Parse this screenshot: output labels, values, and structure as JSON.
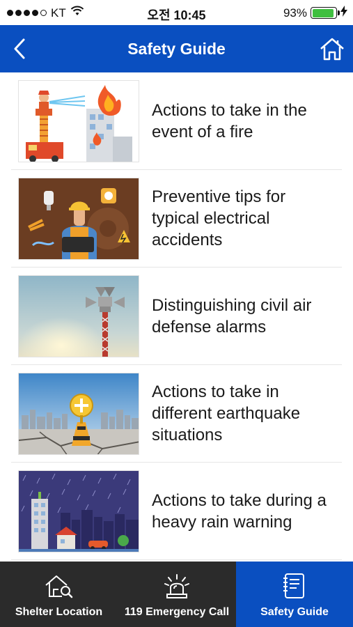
{
  "status_bar": {
    "carrier": "KT",
    "time": "오전 10:45",
    "battery_percent": "93%",
    "battery_level": 0.93,
    "signal_bars_filled": 4,
    "signal_bars_total": 5
  },
  "nav": {
    "title": "Safety Guide",
    "back_icon": "chevron-left-icon",
    "home_icon": "home-icon"
  },
  "guides": [
    {
      "title": "Actions to take in the event of a fire",
      "image": "firefighter-illustration"
    },
    {
      "title": "Preventive tips for typical electrical accidents",
      "image": "electrician-illustration"
    },
    {
      "title": "Distinguishing civil air defense alarms",
      "image": "siren-tower-photo"
    },
    {
      "title": "Actions to take in different earthquake situations",
      "image": "earthquake-crack-illustration"
    },
    {
      "title": "Actions to take during a heavy rain warning",
      "image": "heavy-rain-city-illustration"
    }
  ],
  "tabs": [
    {
      "label": "Shelter Location",
      "icon": "shelter-search-icon",
      "active": false
    },
    {
      "label": "119 Emergency Call",
      "icon": "emergency-siren-icon",
      "active": false
    },
    {
      "label": "Safety Guide",
      "icon": "guide-book-icon",
      "active": true
    }
  ],
  "colors": {
    "primary": "#0a4fc0",
    "tab_bar": "#2b2b2b",
    "battery": "#3fbf3f"
  }
}
